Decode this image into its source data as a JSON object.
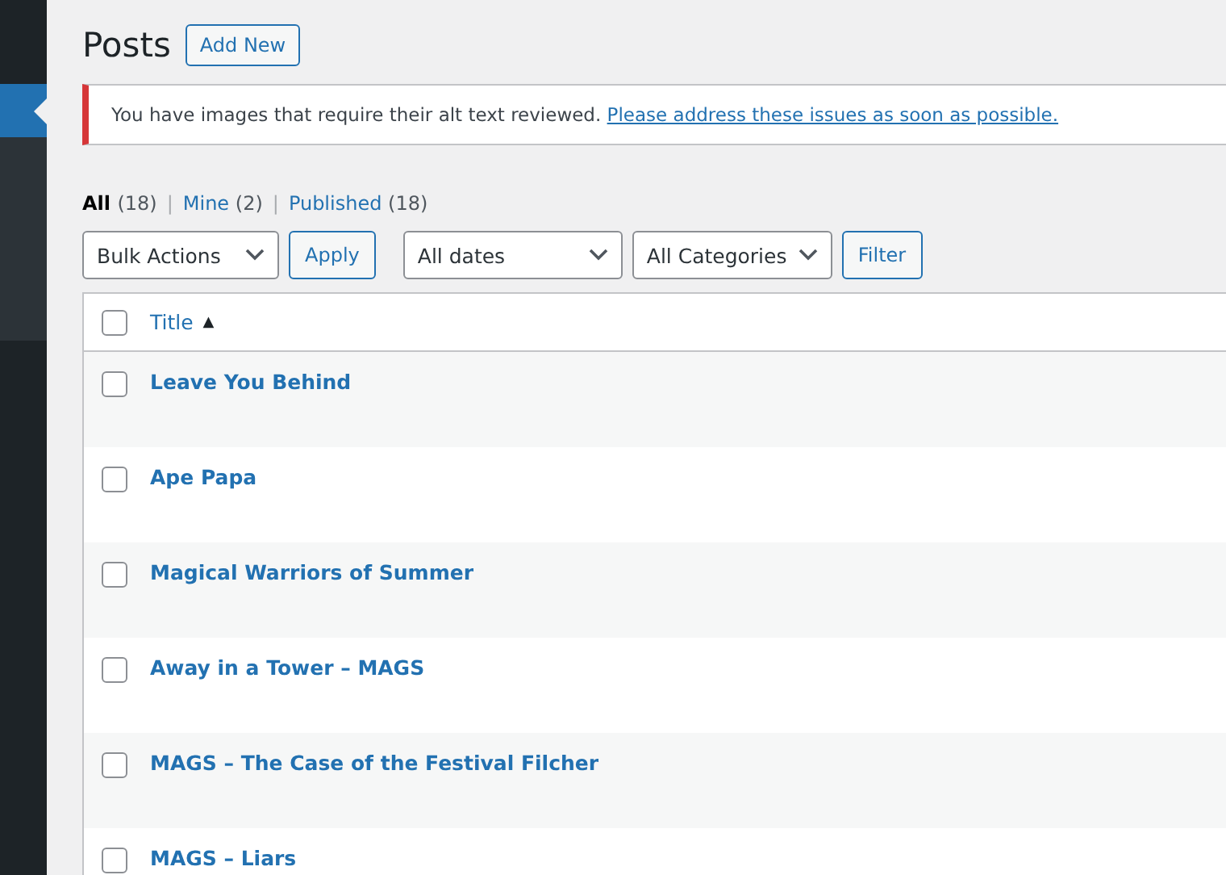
{
  "sidebar": {
    "items": [
      {
        "selected": true
      }
    ]
  },
  "page": {
    "title": "Posts",
    "add_new": "Add New"
  },
  "notice": {
    "text": "You have images that require their alt text reviewed.",
    "link": "Please address these issues as soon as possible."
  },
  "views_separator": "|",
  "views": [
    {
      "label": "All",
      "count": "(18)",
      "selected": true
    },
    {
      "label": "Mine",
      "count": "(2)",
      "selected": false
    },
    {
      "label": "Published",
      "count": "(18)",
      "selected": false
    }
  ],
  "tablenav": {
    "bulk_actions": "Bulk Actions",
    "apply": "Apply",
    "dates": "All dates",
    "categories": "All Categories",
    "filter": "Filter"
  },
  "table": {
    "header": {
      "label": "Title",
      "sort": "▲",
      "checked": false
    },
    "rows": [
      {
        "title": "Leave You Behind",
        "checked": false
      },
      {
        "title": "Ape Papa",
        "checked": false
      },
      {
        "title": "Magical Warriors of Summer",
        "checked": false
      },
      {
        "title": "Away in a Tower – MAGS",
        "checked": false
      },
      {
        "title": "MAGS – The Case of the Festival Filcher",
        "checked": false
      },
      {
        "title": "MAGS – Liars",
        "checked": false
      }
    ]
  }
}
